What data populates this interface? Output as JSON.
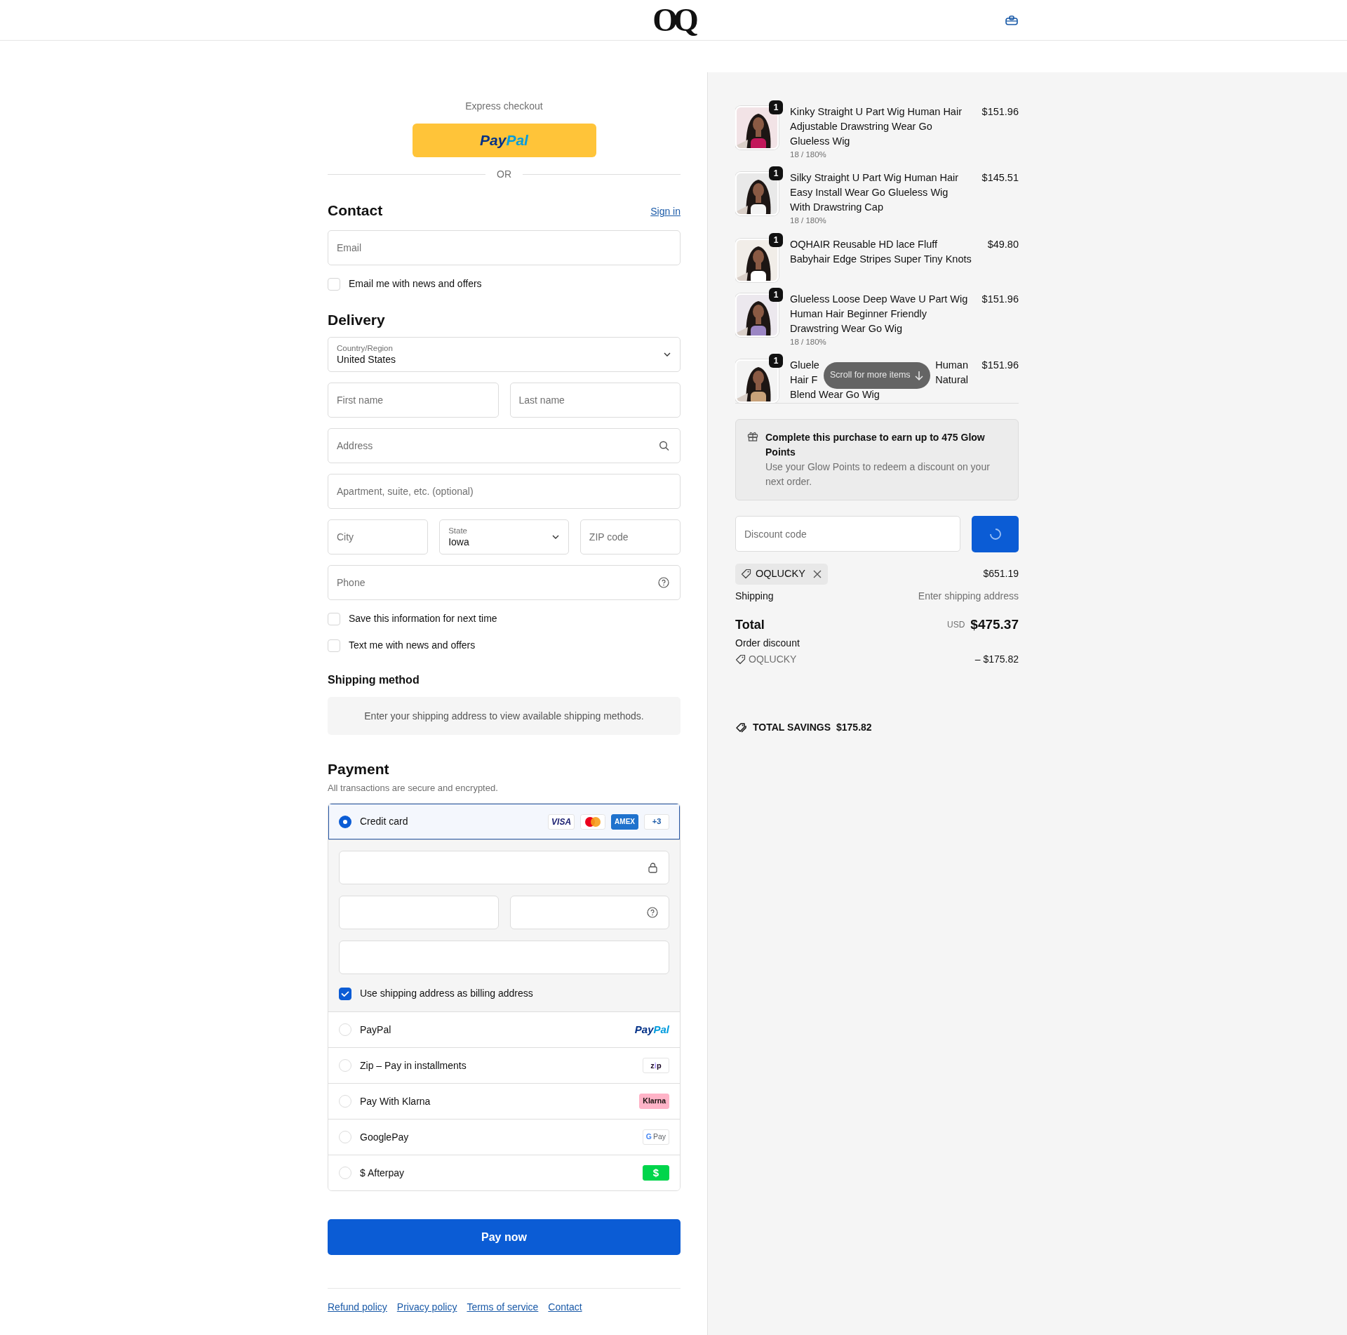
{
  "header": {
    "logo": "OQ"
  },
  "express": {
    "label": "Express checkout",
    "paypal_logo": [
      "Pay",
      "Pal"
    ],
    "divider": "OR"
  },
  "contact": {
    "title": "Contact",
    "sign_in": "Sign in",
    "email": {
      "placeholder": "Email"
    },
    "newsletter": {
      "label": "Email me with news and offers",
      "checked": false
    }
  },
  "delivery": {
    "title": "Delivery",
    "rows": [
      [
        {
          "kind": "select",
          "label": "Country/Region",
          "value": "United States"
        }
      ],
      [
        {
          "kind": "text",
          "placeholder": "First name"
        },
        {
          "kind": "text",
          "placeholder": "Last name"
        }
      ],
      [
        {
          "kind": "search",
          "placeholder": "Address"
        }
      ],
      [
        {
          "kind": "text",
          "placeholder": "Apartment, suite, etc. (optional)"
        }
      ],
      [
        {
          "kind": "text",
          "placeholder": "City"
        },
        {
          "kind": "select",
          "label": "State",
          "value": "Iowa"
        },
        {
          "kind": "text",
          "placeholder": "ZIP code"
        }
      ],
      [
        {
          "kind": "help",
          "placeholder": "Phone"
        }
      ]
    ],
    "checkboxes": [
      {
        "label": "Save this information for next time",
        "checked": false
      },
      {
        "label": "Text me with news and offers",
        "checked": false
      }
    ]
  },
  "shipping_method": {
    "title": "Shipping method",
    "message": "Enter your shipping address to view available shipping methods."
  },
  "payment": {
    "title": "Payment",
    "subtitle": "All transactions are secure and encrypted.",
    "card_brands": [
      {
        "kind": "visa",
        "text": "VISA"
      },
      {
        "kind": "mastercard"
      },
      {
        "kind": "amex",
        "text": "AMEX"
      },
      {
        "kind": "more",
        "text": "+3"
      }
    ],
    "billing_same": {
      "label": "Use shipping address as billing address",
      "checked": true
    },
    "methods": [
      {
        "kind": "card",
        "label": "Credit card",
        "selected": true
      },
      {
        "kind": "paypal",
        "label": "PayPal",
        "selected": false,
        "logo_parts": [
          "Pay",
          "Pal"
        ]
      },
      {
        "kind": "zip",
        "label": "Zip – Pay in installments",
        "selected": false,
        "logo_parts": [
          "z",
          "i",
          "p"
        ]
      },
      {
        "kind": "klarna",
        "label": "Pay With Klarna",
        "selected": false,
        "logo_parts": [
          "Klarna"
        ]
      },
      {
        "kind": "gpay",
        "label": "GooglePay",
        "selected": false,
        "logo_parts": [
          "G",
          "Pay"
        ]
      },
      {
        "kind": "cash",
        "label": "$ Afterpay",
        "selected": false,
        "logo_parts": [
          "$"
        ]
      }
    ]
  },
  "pay_button": "Pay now",
  "footer_links": [
    "Refund policy",
    "Privacy policy",
    "Terms of service",
    "Contact"
  ],
  "order": {
    "items": [
      {
        "quantity": "1",
        "title": "Kinky Straight U Part Wig Human Hair Adjustable Drawstring Wear Go Glueless Wig",
        "variant": "18 / 180%",
        "price": "$151.96"
      },
      {
        "quantity": "1",
        "title": "Silky Straight U Part Wig Human Hair Easy Install Wear Go Glueless Wig With Drawstring Cap",
        "variant": "18 / 180%",
        "price": "$145.51"
      },
      {
        "quantity": "1",
        "title": "OQHAIR Reusable HD lace Fluff Babyhair Edge Stripes Super Tiny Knots",
        "price": "$49.80"
      },
      {
        "quantity": "1",
        "title": "Glueless Loose Deep Wave U Part Wig Human Hair Beginner Friendly Drawstring Wear Go Wig",
        "variant": "18 / 180%",
        "price": "$151.96"
      },
      {
        "quantity": "1",
        "title_lines": [
          [
            "Gluele",
            "Human"
          ],
          [
            "Hair F",
            "Natural"
          ],
          [
            "Blend Wear Go Wig"
          ]
        ],
        "price": "$151.96"
      }
    ],
    "scroll_hint": "Scroll for more items"
  },
  "rewards": {
    "title": "Complete this purchase to earn up to 475 Glow Points",
    "text": "Use your Glow Points to redeem a discount on your next order."
  },
  "discount": {
    "placeholder": "Discount code",
    "loading": true,
    "applied_code": "OQLUCKY"
  },
  "summary": {
    "subtotal": "$651.19",
    "shipping_label": "Shipping",
    "shipping_value": "Enter shipping address",
    "total_label": "Total",
    "currency": "USD",
    "total": "$475.37",
    "order_discount_label": "Order discount",
    "discount_code": "OQLUCKY",
    "discount_amount": "– $175.82",
    "savings_label": "TOTAL SAVINGS",
    "savings": "$175.82"
  }
}
